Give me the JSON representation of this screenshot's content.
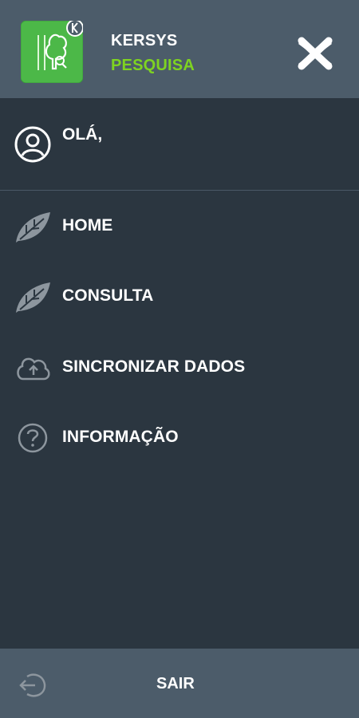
{
  "header": {
    "brand_name": "KERSYS",
    "brand_sub": "PESQUISA",
    "logo_icon": "kersys-tree-logo-icon",
    "close_icon": "close-x-icon"
  },
  "user": {
    "greeting": "OLÁ,",
    "icon": "user-circle-icon"
  },
  "menu": {
    "items": [
      {
        "label": "HOME",
        "icon": "leaf-icon"
      },
      {
        "label": "CONSULTA",
        "icon": "leaf-icon"
      },
      {
        "label": "SINCRONIZAR DADOS",
        "icon": "cloud-upload-icon"
      },
      {
        "label": "INFORMAÇÃO",
        "icon": "question-circle-icon"
      }
    ]
  },
  "footer": {
    "logout_label": "SAIR",
    "logout_icon": "logout-icon"
  },
  "colors": {
    "drawer_bg": "#2b3640",
    "header_bg": "#4c5c6a",
    "accent_green": "#7ed321",
    "icon_gray": "#8d969e"
  }
}
